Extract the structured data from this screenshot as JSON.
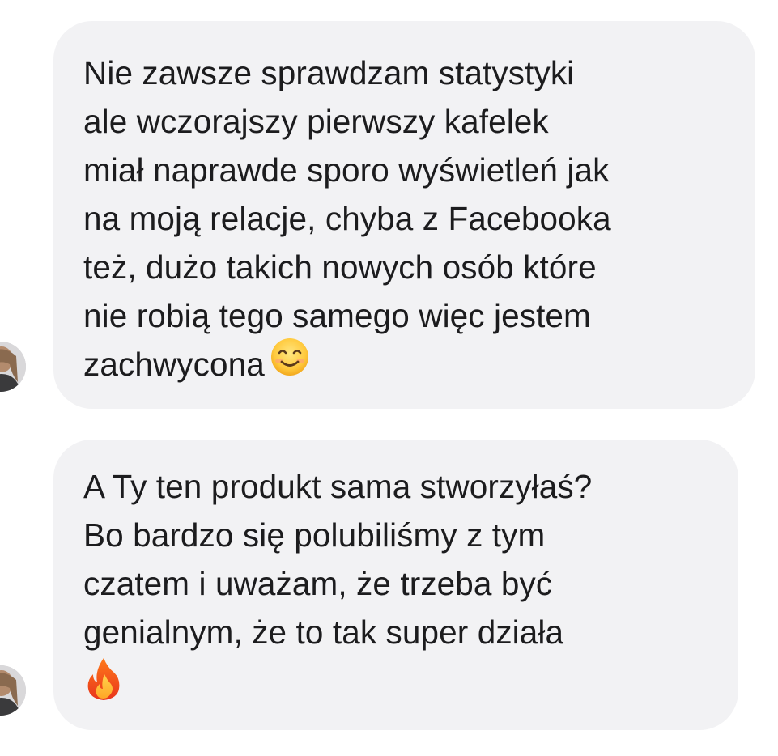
{
  "messages": [
    {
      "lines": [
        "Nie zawsze sprawdzam statystyki",
        "ale wczorajszy pierwszy kafelek",
        "miał naprawde sporo wyświetleń jak",
        "na moją relacje, chyba z Facebooka",
        "też, dużo takich nowych osób które",
        "nie robią tego samego więc jestem",
        "zachwycona"
      ],
      "emoji": "smiling-face-icon"
    },
    {
      "lines": [
        "A Ty ten produkt sama stworzyłaś?",
        "Bo bardzo się polubiliśmy z tym",
        "czatem i uważam, że trzeba być",
        "genialnym, że to tak super działa"
      ],
      "emoji": "fire-icon"
    }
  ],
  "colors": {
    "bubble": "#f2f2f4",
    "text": "#1c1c1e",
    "background": "#ffffff"
  }
}
